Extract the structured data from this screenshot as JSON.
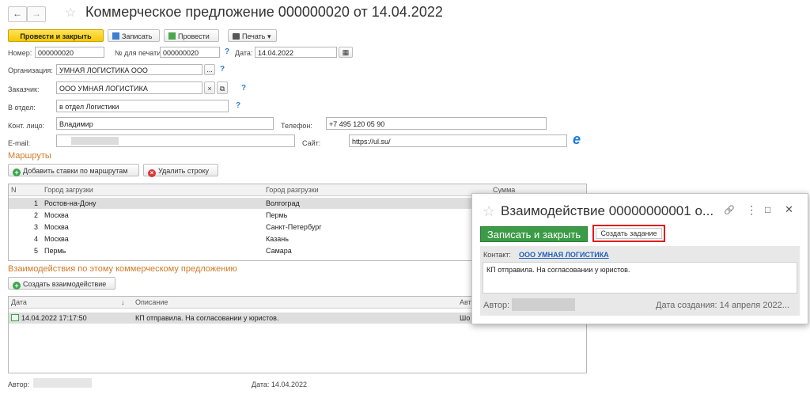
{
  "window": {
    "title": "Коммерческое предложение 000000020 от 14.04.2022",
    "back_glyph": "←",
    "forward_glyph": "→",
    "star_glyph": "☆"
  },
  "toolbar": {
    "post_close": "Провести и закрыть",
    "save": "Записать",
    "post": "Провести",
    "print": "Печать ▾"
  },
  "form": {
    "number_label": "Номер:",
    "number_value": "000000020",
    "print_number_label": "№ для печати:",
    "print_number_value": "000000020",
    "date_label": "Дата:",
    "date_value": "14.04.2022",
    "org_label": "Организация:",
    "org_value": "УМНАЯ ЛОГИСТИКА ООО",
    "customer_label": "Заказчик:",
    "customer_value": "ООО УМНАЯ ЛОГИСТИКА",
    "dept_label": "В отдел:",
    "dept_value": "в отдел Логистики",
    "contact_label": "Конт. лицо:",
    "contact_value": "Владимир",
    "phone_label": "Телефон:",
    "phone_value": "+7 495 120 05 90",
    "email_label": "E-mail:",
    "site_label": "Сайт:",
    "site_value": "https://ul.su/",
    "help_glyph": "?",
    "calendar_glyph": "▦",
    "clear_glyph": "×",
    "ellipsis_glyph": "..."
  },
  "routes": {
    "section_title": "Маршруты",
    "add_button": "Добавить ставки по маршрутам",
    "delete_button": "Удалить строку",
    "columns": [
      "N",
      "Город загрузки",
      "Город разгрузки",
      "Сумма"
    ],
    "rows": [
      {
        "n": "1",
        "from": "Ростов-на-Дону",
        "to": "Волгоград"
      },
      {
        "n": "2",
        "from": "Москва",
        "to": "Пермь"
      },
      {
        "n": "3",
        "from": "Москва",
        "to": "Санкт-Петербург"
      },
      {
        "n": "4",
        "from": "Москва",
        "to": "Казань"
      },
      {
        "n": "5",
        "from": "Пермь",
        "to": "Самара"
      }
    ]
  },
  "interactions": {
    "section_title": "Взаимодействия по этому коммерческому предложению",
    "create_button": "Создать взаимодействие",
    "columns": [
      "Дата",
      "↓",
      "Описание",
      "Авт"
    ],
    "rows": [
      {
        "date": "14.04.2022 17:17:50",
        "desc": "КП отправила. На согласовании у юристов.",
        "author": "Шо"
      }
    ]
  },
  "footer": {
    "author_label": "Автор:",
    "date_label": "Дата: 14.04.2022"
  },
  "popup": {
    "title": "Взаимодействие 00000000001 о...",
    "save_close": "Записать и закрыть",
    "create_task": "Создать задание",
    "contact_label": "Контакт:",
    "contact_value": "ООО УМНАЯ ЛОГИСТИКА",
    "text": "КП отправила. На согласовании у юристов.",
    "author_label": "Автор:",
    "created": "Дата создания: 14 апреля 2022...",
    "link_glyph": "🔗",
    "more_glyph": "⋮",
    "max_glyph": "□",
    "close_glyph": "✕"
  },
  "colors": {
    "accent_yellow": "#f5c900",
    "section_orange": "#d07a28",
    "green": "#3b9b46",
    "highlight_red": "#e11b1b",
    "link_blue": "#1f5fb8"
  }
}
